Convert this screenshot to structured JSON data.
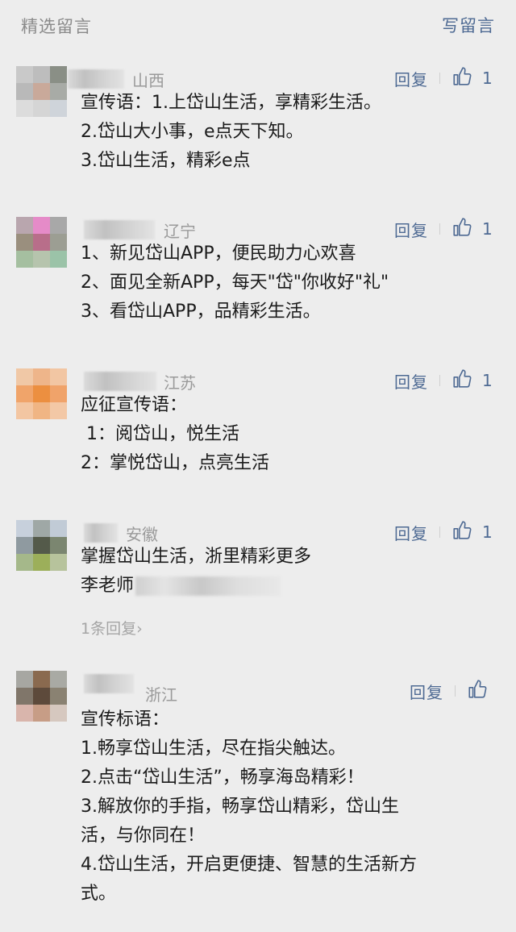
{
  "header": {
    "title": "精选留言",
    "write_label": "写留言"
  },
  "colors": {
    "link": "#4e6a93",
    "muted": "#9a9a9a",
    "background": "#ededed"
  },
  "comments": [
    {
      "region": "山西",
      "reply_label": "回复",
      "likes": "1",
      "lines": [
        "宣传语：1.上岱山生活，享精彩生活。",
        "2.岱山大小事，e点天下知。",
        "3.岱山生活，精彩e点"
      ]
    },
    {
      "region": "辽宁",
      "reply_label": "回复",
      "likes": "1",
      "lines": [
        "1、新见岱山APP，便民助力心欢喜",
        "2、面见全新APP，每天\"岱\"你收好\"礼\"",
        "3、看岱山APP，品精彩生活。"
      ]
    },
    {
      "region": "江苏",
      "reply_label": "回复",
      "likes": "1",
      "lines": [
        "应征宣传语：",
        " 1：阅岱山，悦生活",
        "2：掌悦岱山，点亮生活"
      ]
    },
    {
      "region": "安徽",
      "reply_label": "回复",
      "likes": "1",
      "lines": [
        "掌握岱山生活，浙里精彩更多",
        "李老师"
      ],
      "more_replies": "1条回复›"
    },
    {
      "region": "浙江",
      "reply_label": "回复",
      "likes": "",
      "lines": [
        "宣传标语：",
        "1.畅享岱山生活，尽在指尖触达。",
        "2.点击“岱山生活”，畅享海岛精彩！",
        "3.解放你的手指，畅享岱山精彩，岱山生",
        "活，与你同在！",
        "4.岱山生活，开启更便捷、智慧的生活新方",
        "式。"
      ]
    }
  ]
}
